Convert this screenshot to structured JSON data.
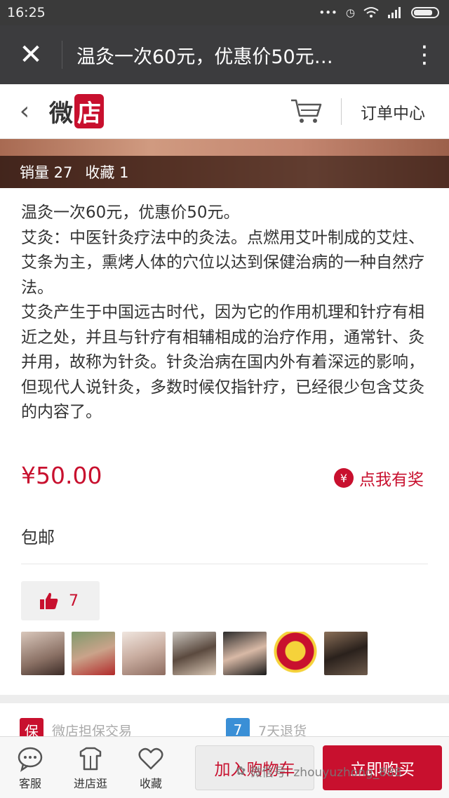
{
  "status_bar": {
    "time": "16:25",
    "icons": [
      "more-dots-icon",
      "alarm-icon",
      "wifi-icon",
      "signal-icon",
      "battery-icon"
    ]
  },
  "title_bar": {
    "title": "温灸一次60元，优惠价50元…",
    "close_icon": "close-icon",
    "menu_icon": "more-vertical-icon"
  },
  "shop_header": {
    "logo_text": "微",
    "logo_box_text": "店",
    "orders_label": "订单中心",
    "cart_icon": "cart-icon",
    "back_icon": "chevron-left-icon"
  },
  "product": {
    "sales_label": "销量 27",
    "favorites_label": "收藏 1",
    "description": [
      "温灸一次60元，优惠价50元。",
      "艾灸：中医针灸疗法中的灸法。点燃用艾叶制成的艾炷、艾条为主，熏烤人体的穴位以达到保健治病的一种自然疗法。",
      "艾灸产生于中国远古时代，因为它的作用机理和针疗有相近之处，并且与针疗有相辅相成的治疗作用，通常针、灸并用，故称为针灸。针灸治病在国内外有着深远的影响，但现代人说针灸，多数时候仅指针疗，已经很少包含艾灸的内容了。"
    ],
    "price": "¥50.00",
    "reward_coin": "¥",
    "reward_label": "点我有奖",
    "shipping": "包邮",
    "like_count": "7"
  },
  "likers": [
    "avatar-1",
    "avatar-2",
    "avatar-3",
    "avatar-4",
    "avatar-5",
    "avatar-6",
    "avatar-7"
  ],
  "guarantees": [
    {
      "icon_text": "保",
      "label": "微店担保交易",
      "color": "#c8102e"
    },
    {
      "icon_text": "7",
      "label": "7天退货",
      "color": "#3a8fd6"
    }
  ],
  "bottom_bar": {
    "service_label": "客服",
    "shop_label": "进店逛",
    "favorite_label": "收藏",
    "add_cart_label": "加入购物车",
    "buy_label": "立即购买",
    "watermark": "微信号: zhouyuzhong_888"
  },
  "colors": {
    "accent": "#c8102e",
    "title_bar": "#3c3c3e",
    "status_bar": "#3a3a3a"
  }
}
